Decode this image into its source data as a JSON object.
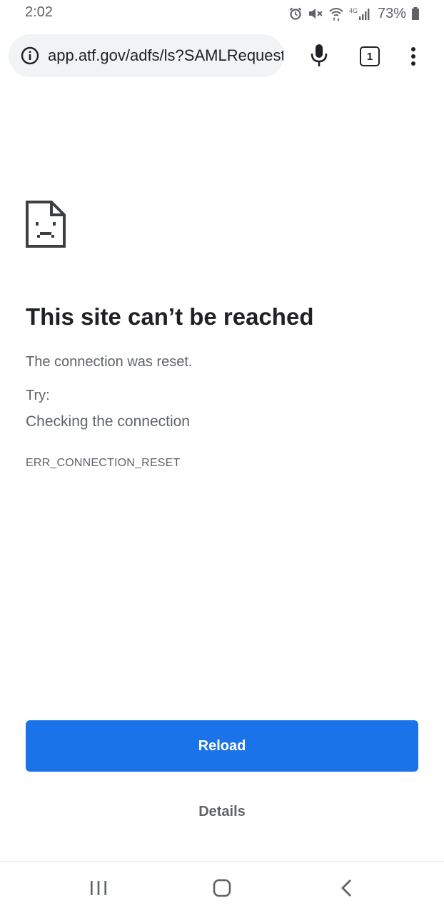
{
  "status_bar": {
    "time": "2:02",
    "battery_text": "73%",
    "network_label": "4G",
    "icons": [
      "alarm-icon",
      "mute-icon",
      "wifi-icon",
      "cell-signal-icon",
      "battery-icon"
    ]
  },
  "toolbar": {
    "url": "app.atf.gov/adfs/ls?SAMLRequest",
    "tab_count": "1",
    "icons": [
      "info-icon",
      "microphone-icon",
      "tab-switcher-icon",
      "overflow-menu-icon"
    ]
  },
  "error": {
    "icon": "sad-page-icon",
    "title": "This site can’t be reached",
    "summary": "The connection was reset.",
    "try_label": "Try:",
    "suggestion": "Checking the connection",
    "code": "ERR_CONNECTION_RESET"
  },
  "actions": {
    "reload_label": "Reload",
    "details_label": "Details"
  },
  "nav_bar": {
    "icons": [
      "recents-icon",
      "home-icon",
      "back-icon"
    ]
  },
  "colors": {
    "accent": "#1a73e8",
    "text_primary": "#202124",
    "text_secondary": "#5f6368",
    "omnibox_bg": "#f1f3f4"
  }
}
